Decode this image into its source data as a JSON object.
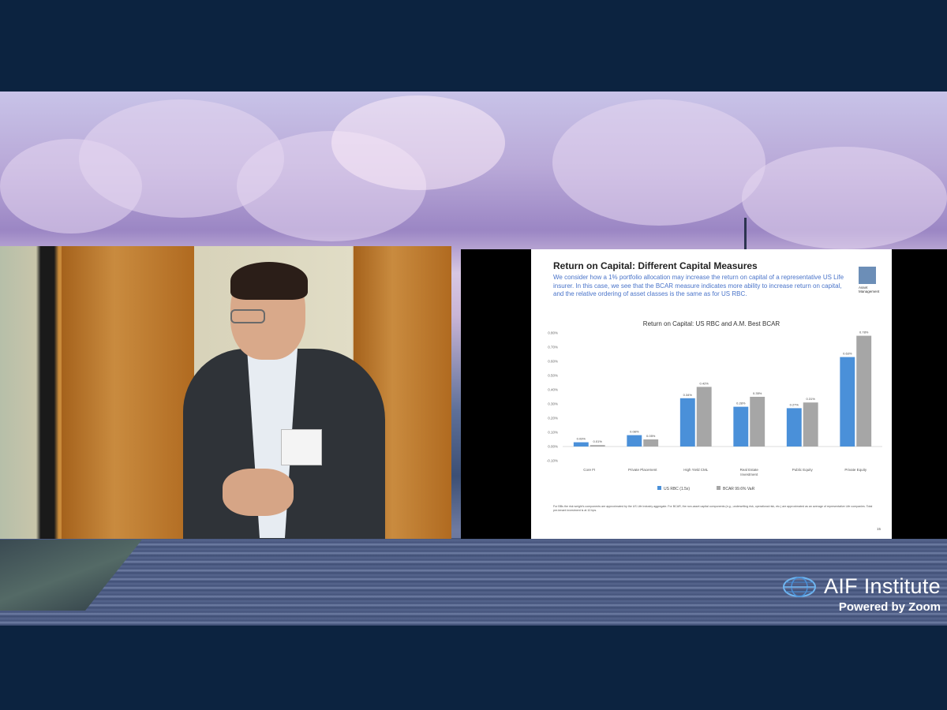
{
  "slide": {
    "title": "Return on Capital: Different Capital Measures",
    "subtitle": "We consider how a 1% portfolio allocation may increase the return on capital of a representative US Life insurer. In this case, we see that the BCAR measure indicates more ability to increase return on capital, and the relative ordering of asset classes is the same as for US RBC.",
    "logo_text": "Asset Management",
    "footnote": "For BBs the risk weight's components are approximated by the US Life industry aggregate. For BCAR, the non-asset capital components (e.g., underwriting risk, operational risk, etc.) are approximated as an average of representative Life companies. Total pre-tenant investment is at 10 bps.",
    "page_number": "15"
  },
  "chart_data": {
    "type": "bar",
    "title": "Return on Capital: US RBC and A.M. Best BCAR",
    "categories": [
      "Core FI",
      "Private Placement",
      "High Yield CML",
      "Real Estate Investment",
      "Public Equity",
      "Private Equity"
    ],
    "ylim": [
      -0.1,
      0.8
    ],
    "yticks": [
      "-0.10%",
      "0.00%",
      "0.10%",
      "0.20%",
      "0.30%",
      "0.40%",
      "0.50%",
      "0.60%",
      "0.70%",
      "0.80%"
    ],
    "series": [
      {
        "name": "US RBC (1.5x)",
        "color": "#4a90d9",
        "values": [
          0.03,
          0.08,
          0.34,
          0.28,
          0.27,
          0.63
        ],
        "labels": [
          "0.03%",
          "0.08%",
          "0.34%",
          "0.28%",
          "0.27%",
          "0.63%"
        ]
      },
      {
        "name": "BCAR 99.6% VaR",
        "color": "#a6a6a6",
        "values": [
          0.01,
          0.05,
          0.42,
          0.35,
          0.31,
          0.78
        ],
        "labels": [
          "0.01%",
          "0.05%",
          "0.42%",
          "0.35%",
          "0.31%",
          "0.78%"
        ]
      }
    ],
    "legend_position": "bottom"
  },
  "branding": {
    "name": "AIF Institute",
    "powered_by": "Powered by Zoom",
    "icon": "globe-icon"
  }
}
